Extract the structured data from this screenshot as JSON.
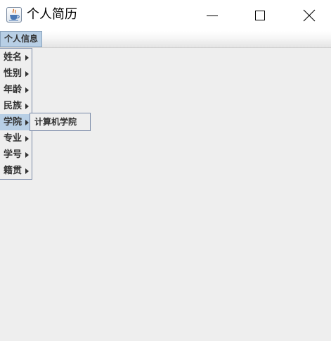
{
  "window": {
    "title": "个人简历",
    "icon": "java-coffee-cup-icon",
    "controls": [
      "minimize-icon",
      "maximize-icon",
      "close-icon"
    ]
  },
  "menubar": {
    "menus": [
      {
        "label": "个人信息",
        "open": true
      }
    ]
  },
  "popup": {
    "items": [
      {
        "label": "姓名",
        "has_submenu": true
      },
      {
        "label": "性别",
        "has_submenu": true
      },
      {
        "label": "年龄",
        "has_submenu": true
      },
      {
        "label": "民族",
        "has_submenu": true
      },
      {
        "label": "学院",
        "has_submenu": true,
        "active": true
      },
      {
        "label": "专业",
        "has_submenu": true
      },
      {
        "label": "学号",
        "has_submenu": true
      },
      {
        "label": "籍贯",
        "has_submenu": true
      }
    ]
  },
  "submenu": {
    "items": [
      {
        "label": "计算机学院"
      }
    ]
  },
  "colors": {
    "highlight": "#b8cfe5",
    "background": "#eeeeee",
    "menu_border": "#7a8aa8"
  }
}
